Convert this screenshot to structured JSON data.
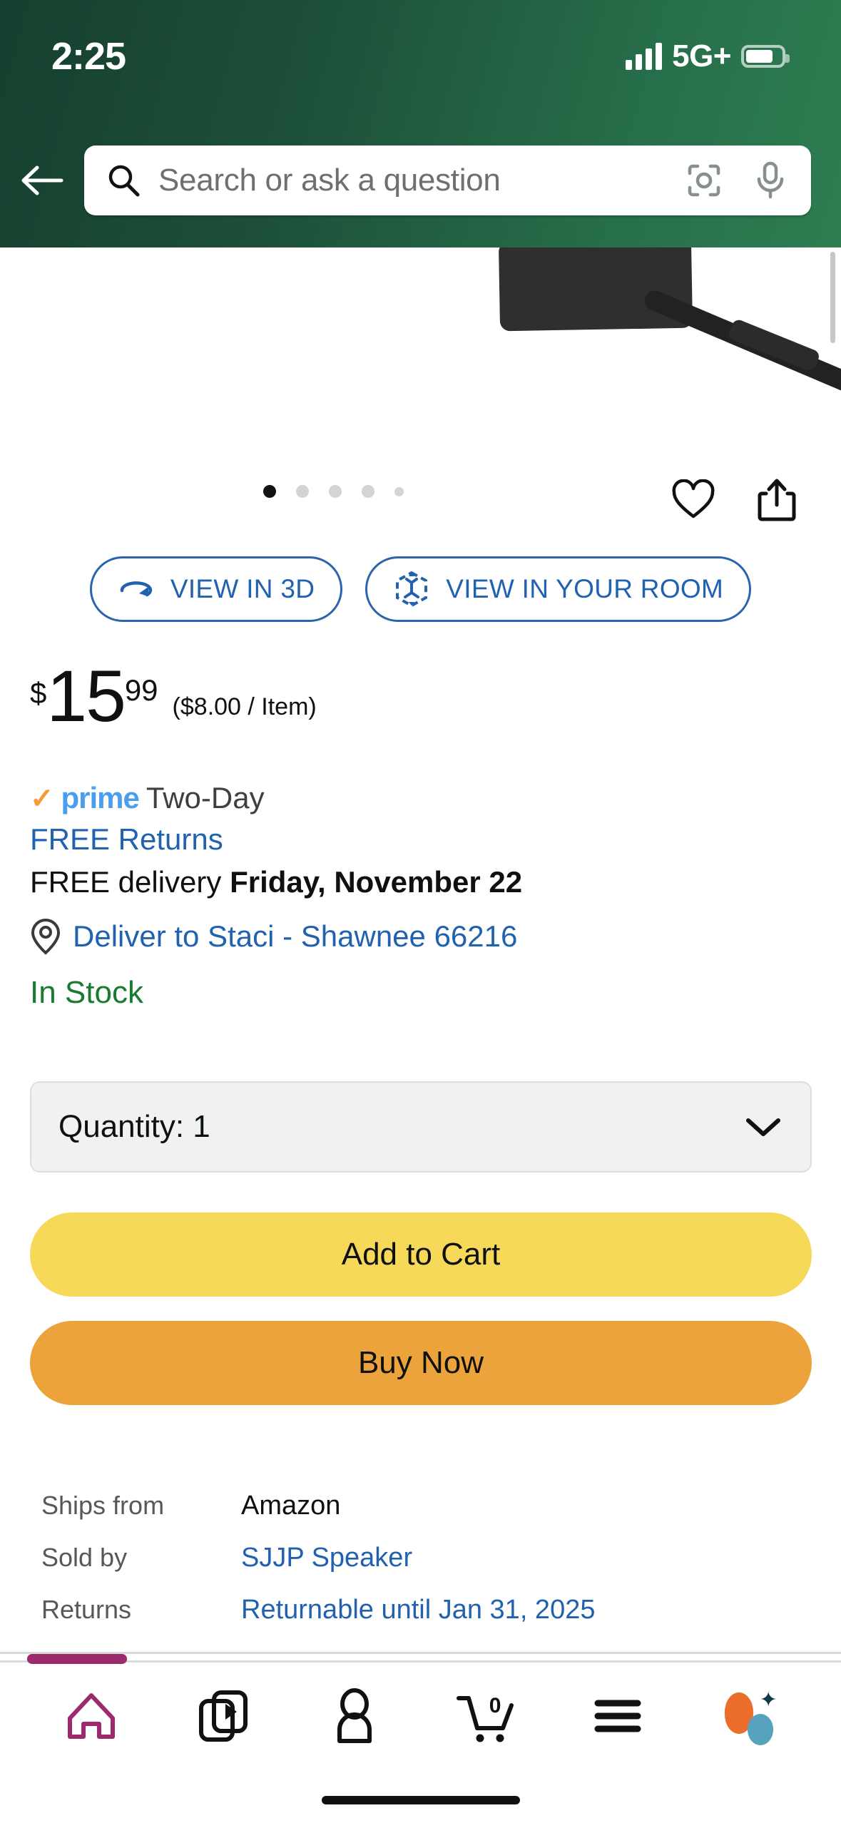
{
  "status_bar": {
    "time": "2:25",
    "network": "5G+",
    "signal_icon": "signal-bars-icon",
    "battery_icon": "battery-icon"
  },
  "header": {
    "back_icon": "back-arrow-icon",
    "search": {
      "placeholder": "Search or ask a question",
      "value": "",
      "search_icon": "search-icon",
      "camera_icon": "camera-scan-icon",
      "mic_icon": "microphone-icon"
    }
  },
  "gallery": {
    "total_dots": 5,
    "active_index": 0,
    "wishlist_icon": "heart-icon",
    "share_icon": "share-icon"
  },
  "view_buttons": [
    {
      "label": "VIEW IN 3D",
      "icon": "rotate-3d-icon"
    },
    {
      "label": "VIEW IN YOUR ROOM",
      "icon": "ar-cube-icon"
    }
  ],
  "price": {
    "currency": "$",
    "whole": "15",
    "fraction": "99",
    "per_item": "($8.00 / Item)"
  },
  "delivery": {
    "prime_check": "✓",
    "prime_word": "prime",
    "prime_suffix": "Two-Day",
    "free_returns": "FREE Returns",
    "free_delivery_prefix": "FREE delivery ",
    "free_delivery_date": "Friday, November 22",
    "deliver_to": "Deliver to Staci - Shawnee 66216",
    "location_icon": "location-pin-icon",
    "stock_status": "In Stock"
  },
  "quantity": {
    "label": "Quantity:  1",
    "value": "1",
    "chevron_icon": "chevron-down-icon"
  },
  "actions": {
    "add_to_cart": "Add to Cart",
    "buy_now": "Buy Now"
  },
  "seller_info": [
    {
      "key": "Ships from",
      "value": "Amazon",
      "is_link": false
    },
    {
      "key": "Sold by",
      "value": "SJJP Speaker",
      "is_link": true
    },
    {
      "key": "Returns",
      "value": "Returnable until Jan 31, 2025",
      "is_link": true
    }
  ],
  "bottom_nav": [
    {
      "name": "home",
      "icon": "home-icon",
      "active": true
    },
    {
      "name": "inspire",
      "icon": "video-play-icon",
      "active": false
    },
    {
      "name": "account",
      "icon": "person-icon",
      "active": false
    },
    {
      "name": "cart",
      "icon": "cart-icon",
      "badge": "0",
      "active": false
    },
    {
      "name": "menu",
      "icon": "hamburger-menu-icon",
      "active": false
    },
    {
      "name": "rufus",
      "icon": "rufus-assistant-icon",
      "active": false
    }
  ],
  "colors": {
    "header_green_dark": "#15402f",
    "header_green_light": "#2e7d51",
    "link_blue": "#2162b0",
    "prime_blue": "#4a9ef0",
    "prime_orange": "#f79b34",
    "in_stock_green": "#197b30",
    "add_to_cart_yellow": "#f7d959",
    "buy_now_orange": "#eda33c",
    "nav_active_magenta": "#9e2a6e"
  }
}
